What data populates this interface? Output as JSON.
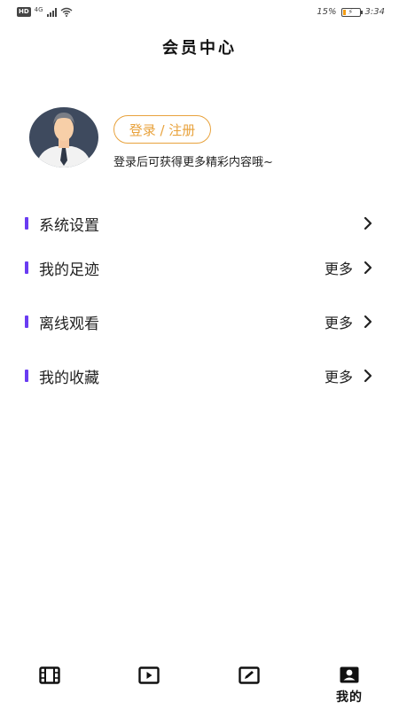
{
  "status_bar": {
    "network_badge": "HD",
    "signal_label": "4G",
    "battery_percent": "15%",
    "time": "3:34"
  },
  "header": {
    "title": "会员中心"
  },
  "profile": {
    "login_button": "登录 / 注册",
    "hint": "登录后可获得更多精彩内容哦~"
  },
  "menu": {
    "items": [
      {
        "label": "系统设置",
        "more": ""
      },
      {
        "label": "我的足迹",
        "more": "更多"
      },
      {
        "label": "离线观看",
        "more": "更多"
      },
      {
        "label": "我的收藏",
        "more": "更多"
      }
    ]
  },
  "tabbar": {
    "tabs": [
      {
        "icon": "film-icon",
        "label": ""
      },
      {
        "icon": "play-icon",
        "label": ""
      },
      {
        "icon": "edit-icon",
        "label": ""
      },
      {
        "icon": "user-icon",
        "label": "我的"
      }
    ],
    "active_index": 3
  },
  "colors": {
    "accent": "#e8a23c",
    "menu_marker": "#6a3cf2"
  }
}
